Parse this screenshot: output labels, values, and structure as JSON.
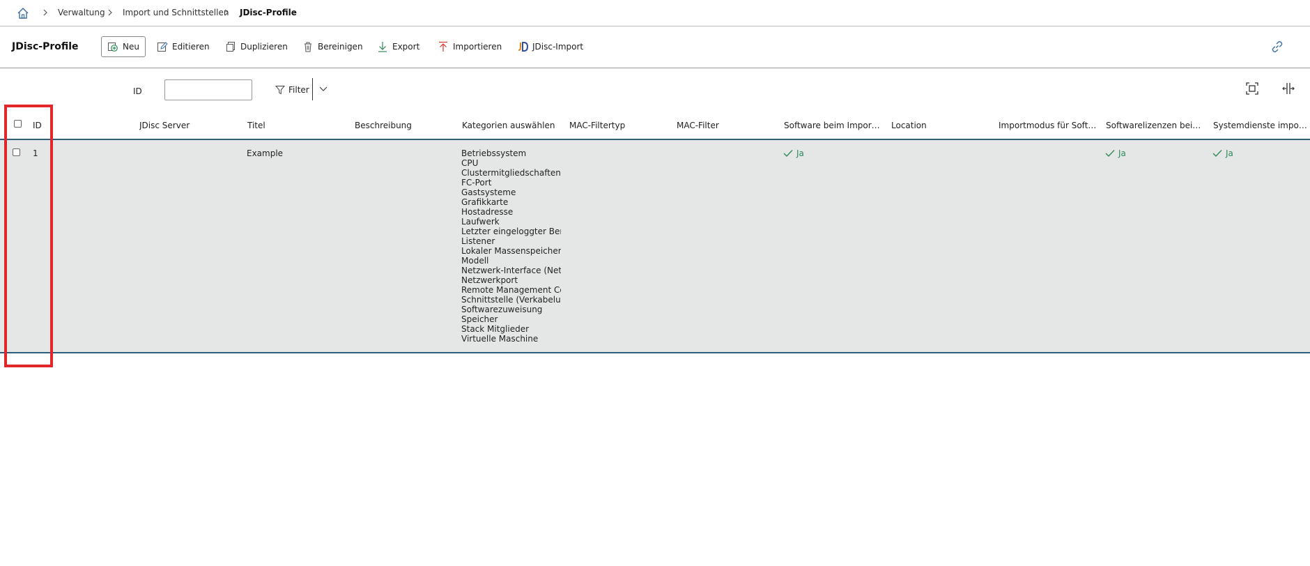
{
  "breadcrumb": {
    "items": [
      "Verwaltung",
      "Import und Schnittstellen",
      "JDisc-Profile"
    ]
  },
  "toolbar": {
    "title": "JDisc-Profile",
    "buttons": {
      "new": "Neu",
      "edit": "Editieren",
      "duplicate": "Duplizieren",
      "purge": "Bereinigen",
      "export": "Export",
      "import": "Importieren",
      "jdisc_import": "JDisc-Import"
    }
  },
  "filter": {
    "id_label": "ID",
    "id_value": "",
    "filter_label": "Filter"
  },
  "table": {
    "columns": [
      "ID",
      "JDisc Server",
      "Titel",
      "Beschreibung",
      "Kategorien auswählen",
      "MAC-Filtertyp",
      "MAC-Filter",
      "Software beim Import b...",
      "Location",
      "Importmodus für Softwa...",
      "Softwarelizenzen beim I...",
      "Systemdienste importieren"
    ],
    "rows": [
      {
        "id": "1",
        "jdisc_server": "",
        "title": "Example",
        "description": "",
        "categories": [
          "Betriebssystem",
          "CPU",
          "Clustermitgliedschaften",
          "FC-Port",
          "Gastsysteme",
          "Grafikkarte",
          "Hostadresse",
          "Laufwerk",
          "Letzter eingeloggter Benutzer",
          "Listener",
          "Lokaler Massenspeicher",
          "Modell",
          "Netzwerk-Interface (Netzwerk)",
          "Netzwerkport",
          "Remote Management Controller",
          "Schnittstelle (Verkabelung)",
          "Softwarezuweisung",
          "Speicher",
          "Stack Mitglieder",
          "Virtuelle Maschine"
        ],
        "mac_filter_type": "",
        "mac_filter": "",
        "software_import": "Ja",
        "location": "",
        "software_import_mode": "",
        "software_licenses": "Ja",
        "system_services": "Ja"
      }
    ]
  },
  "colors": {
    "accent_line": "#2d5f7a",
    "row_bg": "#e5e7e6",
    "yes_green": "#2e8b57",
    "highlight_red": "#e3262a"
  }
}
